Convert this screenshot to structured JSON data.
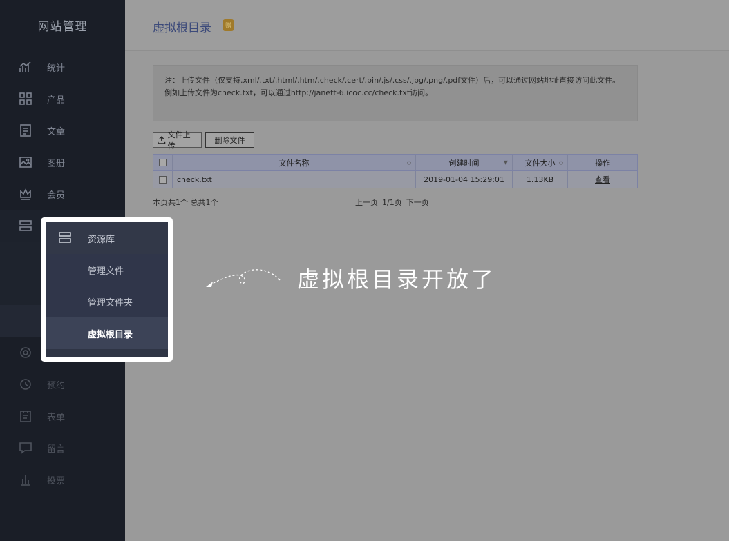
{
  "sidebar": {
    "title": "网站管理",
    "items": [
      {
        "label": "统计",
        "icon": "chart-icon"
      },
      {
        "label": "产品",
        "icon": "grid-icon"
      },
      {
        "label": "文章",
        "icon": "article-icon"
      },
      {
        "label": "图册",
        "icon": "image-icon"
      },
      {
        "label": "会员",
        "icon": "crown-icon"
      },
      {
        "label": "",
        "icon": "server-icon"
      },
      {
        "label": "",
        "icon": "settings-icon"
      },
      {
        "label": "预约",
        "icon": "clock-icon"
      },
      {
        "label": "表单",
        "icon": "form-icon"
      },
      {
        "label": "留言",
        "icon": "message-icon"
      },
      {
        "label": "投票",
        "icon": "vote-icon"
      }
    ]
  },
  "popup": {
    "head_label": "资源库",
    "items": [
      "管理文件",
      "管理文件夹",
      "虚拟根目录"
    ]
  },
  "header": {
    "title": "虚拟根目录",
    "badge": "赠"
  },
  "notice": {
    "line1": "注：上传文件（仅支持.xml/.txt/.html/.htm/.check/.cert/.bin/.js/.css/.jpg/.png/.pdf文件）后，可以通过网站地址直接访问此文件。",
    "line2": "例如上传文件为check.txt，可以通过http://janett-6.icoc.cc/check.txt访问。"
  },
  "toolbar": {
    "upload_label": "文件上传",
    "delete_label": "删除文件"
  },
  "table": {
    "headers": {
      "name": "文件名称",
      "time": "创建时间",
      "size": "文件大小",
      "op": "操作"
    },
    "rows": [
      {
        "name": "check.txt",
        "time": "2019-01-04 15:29:01",
        "size": "1.13KB",
        "op": "查看"
      }
    ]
  },
  "pager": {
    "info": "本页共1个 总共1个",
    "prev": "上一页",
    "page": "1/1页",
    "next": "下一页"
  },
  "annotation": "虚拟根目录开放了"
}
